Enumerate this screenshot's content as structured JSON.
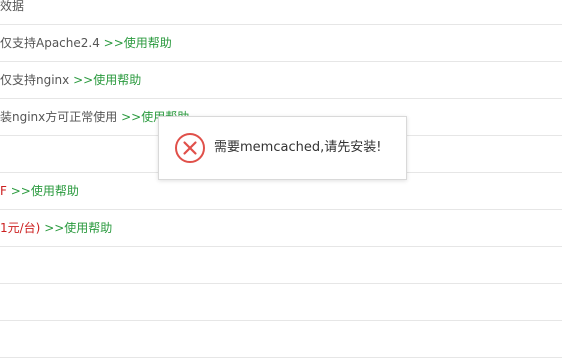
{
  "rows": [
    {
      "prefix": "效据",
      "prefix_class": "gray",
      "link": ""
    },
    {
      "prefix": "仅支持Apache2.4 ",
      "prefix_class": "gray",
      "link": ">>使用帮助"
    },
    {
      "prefix": "仅支持nginx ",
      "prefix_class": "gray",
      "link": ">>使用帮助"
    },
    {
      "prefix": "装nginx方可正常使用 ",
      "prefix_class": "gray",
      "link": ">>使用帮助"
    },
    {
      "prefix": "",
      "prefix_class": "gray",
      "link": ""
    },
    {
      "prefix": "F ",
      "prefix_class": "red",
      "link": ">>使用帮助"
    },
    {
      "prefix": "1元/台) ",
      "prefix_class": "red",
      "link": ">>使用帮助"
    },
    {
      "prefix": "",
      "prefix_class": "gray",
      "link": ""
    },
    {
      "prefix": "",
      "prefix_class": "gray",
      "link": ""
    },
    {
      "prefix": "",
      "prefix_class": "gray",
      "link": ""
    }
  ],
  "toast": {
    "icon": "error-circle-x-icon",
    "message": "需要memcached,请先安装!",
    "icon_color": "#e0504a"
  },
  "colors": {
    "link": "#2a9a3e",
    "warning_text": "#cc1f1f",
    "divider": "#e6e6e6"
  }
}
